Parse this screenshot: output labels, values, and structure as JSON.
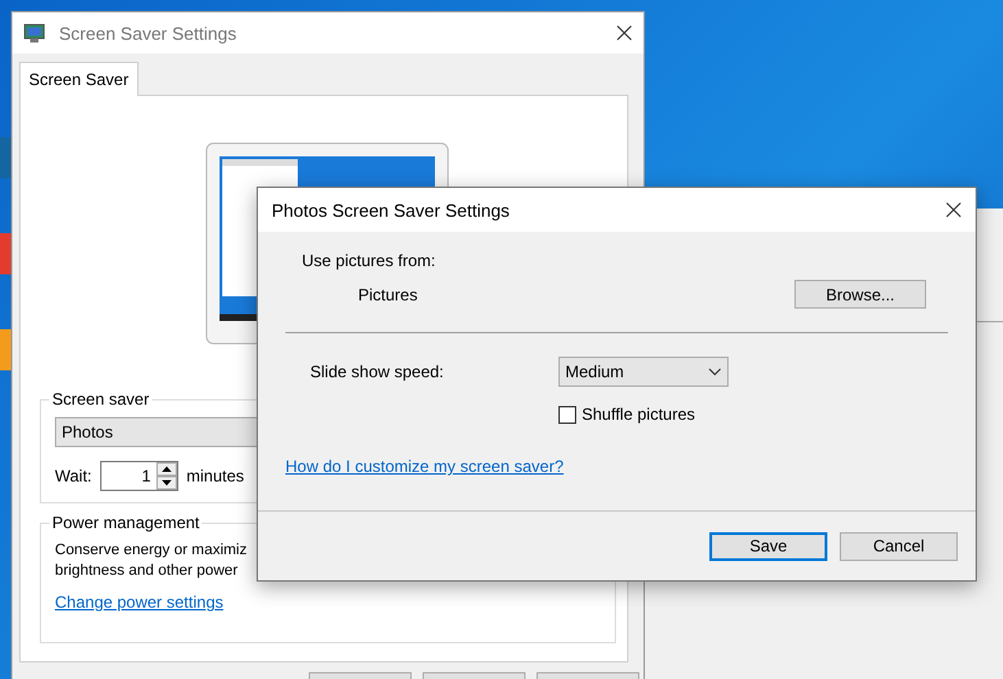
{
  "main_window": {
    "title": "Screen Saver Settings",
    "tabs": [
      {
        "label": "Screen Saver",
        "selected": true
      }
    ],
    "screen_saver": {
      "legend": "Screen saver",
      "selection": "Photos",
      "wait_label": "Wait:",
      "wait_value": "1",
      "wait_unit": "minutes"
    },
    "power": {
      "legend": "Power management",
      "description_lines": [
        "Conserve energy or maximiz",
        "brightness and other power"
      ],
      "link": "Change power settings"
    }
  },
  "dialog": {
    "title": "Photos Screen Saver Settings",
    "source_label": "Use pictures from:",
    "source_value": "Pictures",
    "browse": "Browse...",
    "speed_label": "Slide show speed:",
    "speed_value": "Medium",
    "shuffle": {
      "label": "Shuffle pictures",
      "checked": false
    },
    "help_link": "How do I customize my screen saver?",
    "buttons": [
      {
        "label": "Save",
        "focused": true
      },
      {
        "label": "Cancel",
        "focused": false
      }
    ]
  }
}
